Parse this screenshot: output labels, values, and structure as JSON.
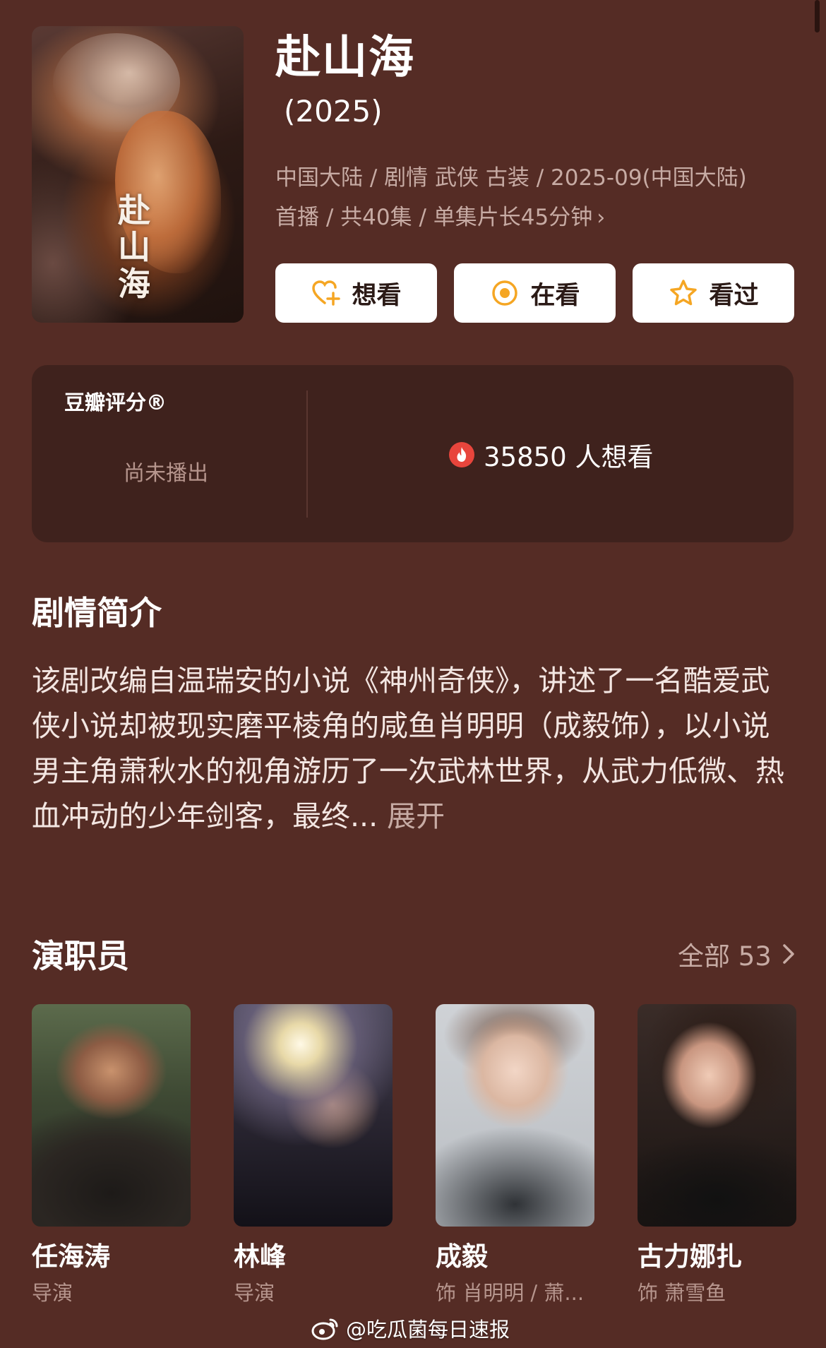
{
  "show": {
    "title": "赴山海",
    "year": "(2025)",
    "meta_line1": "中国大陆 / 剧情 武侠 古装 / 2025-09(中国大陆)",
    "meta_line2": "首播 / 共40集 / 单集片长45分钟",
    "poster_text": "赴山海"
  },
  "actions": {
    "want": "想看",
    "watching": "在看",
    "watched": "看过"
  },
  "rating": {
    "brand": "豆瓣评分®",
    "status": "尚未播出",
    "wishers": "35850 人想看"
  },
  "synopsis": {
    "heading": "剧情简介",
    "text": "该剧改编自温瑞安的小说《神州奇侠》，讲述了一名酷爱武侠小说却被现实磨平棱角的咸鱼肖明明（成毅饰），以小说男主角萧秋水的视角游历了一次武林世界，从武力低微、热血冲动的少年剑客，最终...",
    "more": "展开"
  },
  "cast": {
    "heading": "演职员",
    "all_label": "全部 53",
    "members": [
      {
        "name": "任海涛",
        "role": "导演"
      },
      {
        "name": "林峰",
        "role": "导演"
      },
      {
        "name": "成毅",
        "role": "饰 肖明明 / 萧..."
      },
      {
        "name": "古力娜扎",
        "role": "饰 萧雪鱼"
      }
    ]
  },
  "watermark": "@吃瓜菌每日速报",
  "colors": {
    "background": "#552c25",
    "card": "#3f221d",
    "accent": "#f5a623",
    "fire": "#e8453c"
  }
}
